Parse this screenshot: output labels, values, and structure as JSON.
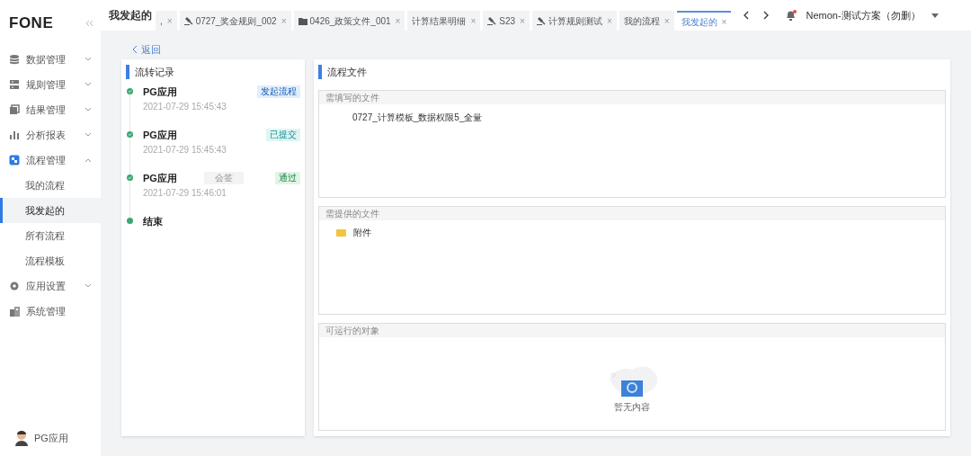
{
  "logo": "FONE",
  "page_title": "我发起的",
  "tabs": [
    {
      "label": ",",
      "kind": "plain",
      "selected": false
    },
    {
      "label": "0727_奖金规则_002",
      "kind": "rule",
      "selected": false
    },
    {
      "label": "0426_政策文件_001",
      "kind": "folder",
      "selected": false
    },
    {
      "label": "计算结果明细",
      "kind": "plain",
      "selected": false
    },
    {
      "label": "S23",
      "kind": "rule",
      "selected": false
    },
    {
      "label": "计算规则测试",
      "kind": "rule",
      "selected": false
    },
    {
      "label": "我的流程",
      "kind": "plain",
      "selected": false
    },
    {
      "label": "我发起的",
      "kind": "plain",
      "selected": true
    }
  ],
  "tab_close": "×",
  "notification": {
    "unread": true
  },
  "project": "Nemon-测试方案（勿删）",
  "sidebar": {
    "items": [
      {
        "label": "数据管理",
        "expanded": false
      },
      {
        "label": "规则管理",
        "expanded": false
      },
      {
        "label": "结果管理",
        "expanded": false
      },
      {
        "label": "分析报表",
        "expanded": false
      },
      {
        "label": "流程管理",
        "expanded": true,
        "children": [
          {
            "label": "我的流程",
            "selected": false
          },
          {
            "label": "我发起的",
            "selected": true
          },
          {
            "label": "所有流程",
            "selected": false
          },
          {
            "label": "流程模板",
            "selected": false
          }
        ]
      },
      {
        "label": "应用设置",
        "expanded": false
      },
      {
        "label": "系统管理"
      }
    ],
    "user": "PG应用"
  },
  "back": "返回",
  "history": {
    "title": "流转记录",
    "records": [
      {
        "name": "PG应用",
        "time": "2021-07-29 15:45:43",
        "status": "发起流程",
        "color": "#e3eefc"
      },
      {
        "name": "PG应用",
        "time": "2021-07-29 15:45:43",
        "status": "已提交",
        "color": "#e0f5f5"
      },
      {
        "name": "PG应用",
        "time": "2021-07-29 15:46:01",
        "note": "会签",
        "status": "通过",
        "color": "#e1f4e8"
      },
      {
        "name": "结束"
      }
    ]
  },
  "files": {
    "title": "流程文件",
    "sections": [
      {
        "title": "需填写的文件",
        "items": [
          {
            "kind": "file",
            "label": "0727_计算模板_数据权限5_全量"
          }
        ]
      },
      {
        "title": "需提供的文件",
        "items": [
          {
            "kind": "folder",
            "label": "附件"
          }
        ]
      },
      {
        "title": "可运行的对象",
        "empty_text": "暂无内容"
      }
    ]
  }
}
